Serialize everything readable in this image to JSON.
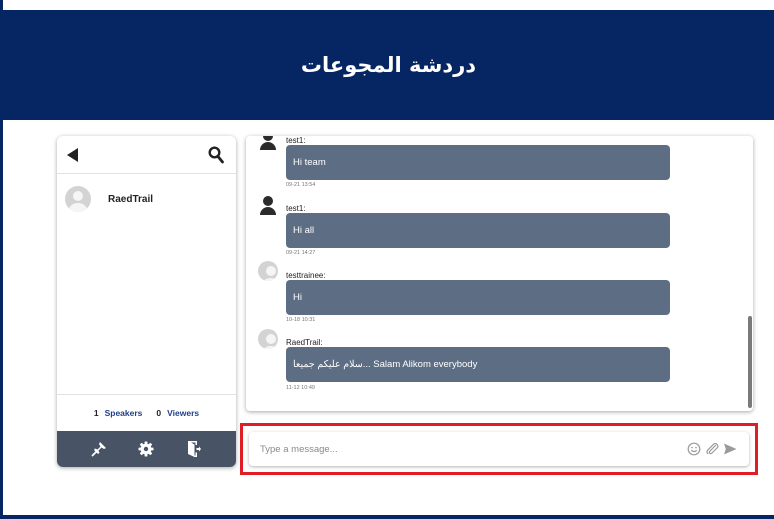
{
  "header": {
    "title": "دردشة المجوعات"
  },
  "participants": {
    "users": [
      {
        "name": "RaedTrail"
      }
    ],
    "stats": {
      "speakers_count": "1",
      "speakers_label": "Speakers",
      "viewers_count": "0",
      "viewers_label": "Viewers"
    },
    "toolbar_icons": [
      "pin-icon",
      "gear-icon",
      "exit-icon"
    ]
  },
  "messages": [
    {
      "sender": "test1:",
      "text": "Hi team",
      "time": "09-21 13:54",
      "avatar": "dark-person"
    },
    {
      "sender": "test1:",
      "text": "Hi all",
      "time": "09-21 14:27",
      "avatar": "dark-person"
    },
    {
      "sender": "testtrainee:",
      "text": "Hi",
      "time": "10-18 10:31",
      "avatar": "gray-default"
    },
    {
      "sender": "RaedTrail:",
      "text": "سلام عليكم جميعا... Salam Alikom everybody",
      "time": "11-12 10:49",
      "avatar": "gray-default"
    }
  ],
  "composer": {
    "placeholder": "Type a message...",
    "icons": [
      "emoji-icon",
      "attachment-icon",
      "send-icon"
    ]
  },
  "colors": {
    "header_bg": "#062563",
    "bubble_bg": "#5d6e84",
    "toolbar_bg": "#485466",
    "highlight_border": "#e01e26",
    "stat_label": "#1d3f8a"
  }
}
